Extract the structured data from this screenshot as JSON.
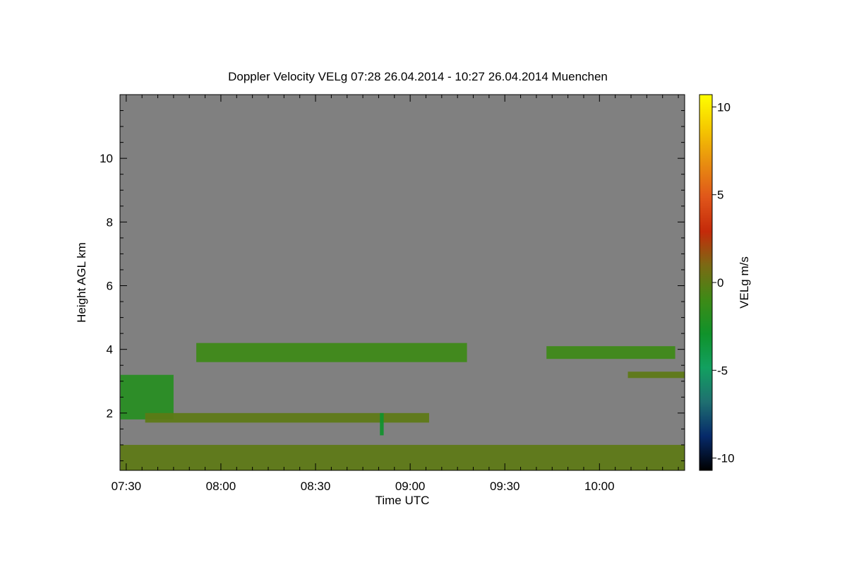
{
  "chart_data": {
    "type": "heatmap",
    "title": "Doppler Velocity VELg   07:28 26.04.2014 - 10:27 26.04.2014 Muenchen",
    "xlabel": "Time UTC",
    "ylabel": "Height AGL km",
    "xticks": [
      "07:30",
      "08:00",
      "08:30",
      "09:00",
      "09:30",
      "10:00"
    ],
    "xtick_hours": [
      7.5,
      8.0,
      8.5,
      9.0,
      9.5,
      10.0
    ],
    "xlim_hours": [
      7.467,
      10.45
    ],
    "yticks": [
      2,
      4,
      6,
      8,
      10
    ],
    "ylim": [
      0.2,
      12.0
    ],
    "colorbar": {
      "label": "VELg m/s",
      "ticks": [
        -10,
        -5,
        0,
        5,
        10
      ],
      "range": [
        -10.7,
        10.7
      ],
      "colormap": [
        "#000000",
        "#062a6a",
        "#1f6f70",
        "#12a060",
        "#10922a",
        "#3e8a16",
        "#7b6a14",
        "#c42a0a",
        "#e0561a",
        "#e88e10",
        "#f5c800",
        "#ffff00"
      ]
    },
    "background_color": "#808080",
    "regions": [
      {
        "name": "mid-level cloud layer",
        "t": [
          7.87,
          9.3
        ],
        "z": [
          3.6,
          4.2
        ],
        "velocity": -1
      },
      {
        "name": "upper layer east",
        "t": [
          9.72,
          10.4
        ],
        "z": [
          3.7,
          4.1
        ],
        "velocity": -1
      },
      {
        "name": "layer at 3.2 km",
        "t": [
          10.15,
          10.45
        ],
        "z": [
          3.1,
          3.3
        ],
        "velocity": 0
      },
      {
        "name": "west low layer",
        "t": [
          7.47,
          7.75
        ],
        "z": [
          1.8,
          3.2
        ],
        "velocity": -2
      },
      {
        "name": "layer at 1.9 km",
        "t": [
          7.6,
          9.1
        ],
        "z": [
          1.7,
          2.0
        ],
        "velocity": 0
      },
      {
        "name": "fall streak",
        "t": [
          8.84,
          8.86
        ],
        "z": [
          1.3,
          2.0
        ],
        "velocity": -3
      },
      {
        "name": "boundary layer",
        "t": [
          7.47,
          10.45
        ],
        "z": [
          0.2,
          1.0
        ],
        "velocity": 0
      }
    ]
  }
}
